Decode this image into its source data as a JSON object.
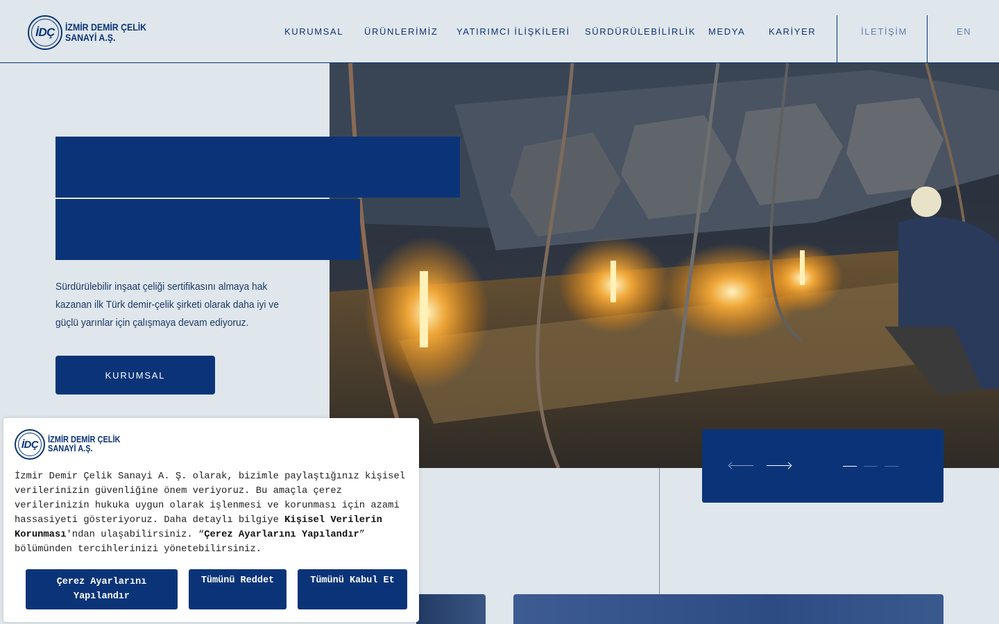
{
  "brand": {
    "logo_mark": "İDÇ",
    "line1": "İZMİR DEMİR ÇELİK",
    "line2": "SANAYİ A.Ş."
  },
  "nav": {
    "items": [
      "KURUMSAL",
      "ÜRÜNLERİMİZ",
      "YATIRIMCI İLİŞKİLERİ",
      "SÜRDÜRÜLEBİLİRLİK",
      "MEDYA",
      "KARİYER"
    ],
    "contact": "İLETİŞİM",
    "language": "EN"
  },
  "hero": {
    "description": "Sürdürülebilir inşaat çeliği sertifikasını almaya hak kazanan ilk Türk demir-çelik şirketi olarak daha iyi ve güçlü yarınlar için çalışmaya devam ediyoruz.",
    "button_label": "KURUMSAL",
    "image_icon": "steel-mill-photo",
    "slider": {
      "total": 3,
      "active": 1
    }
  },
  "cookie": {
    "text_part1": "İzmir Demir Çelik Sanayi A. Ş. olarak, bizimle paylaştığınız kişisel verilerinizin güvenliğine önem veriyoruz. Bu amaçla çerez verilerinizin hukuka uygun olarak işlenmesi ve korunması için azami hassasiyeti gösteriyoruz. Daha detaylı bilgiye ",
    "link_kvkk": "Kişisel Verilerin Korunması",
    "text_part2": "'ndan ulaşabilirsiniz. “",
    "link_settings": "Çerez Ayarlarını Yapılandır",
    "text_part3": "” bölümünden tercihlerinizi yönetebilirsiniz.",
    "btn_configure": "Çerez Ayarlarını Yapılandır",
    "btn_reject": "Tümünü Reddet",
    "btn_accept": "Tümünü Kabul Et"
  },
  "colors": {
    "primary": "#0b3478",
    "background": "#dfe6ec"
  }
}
